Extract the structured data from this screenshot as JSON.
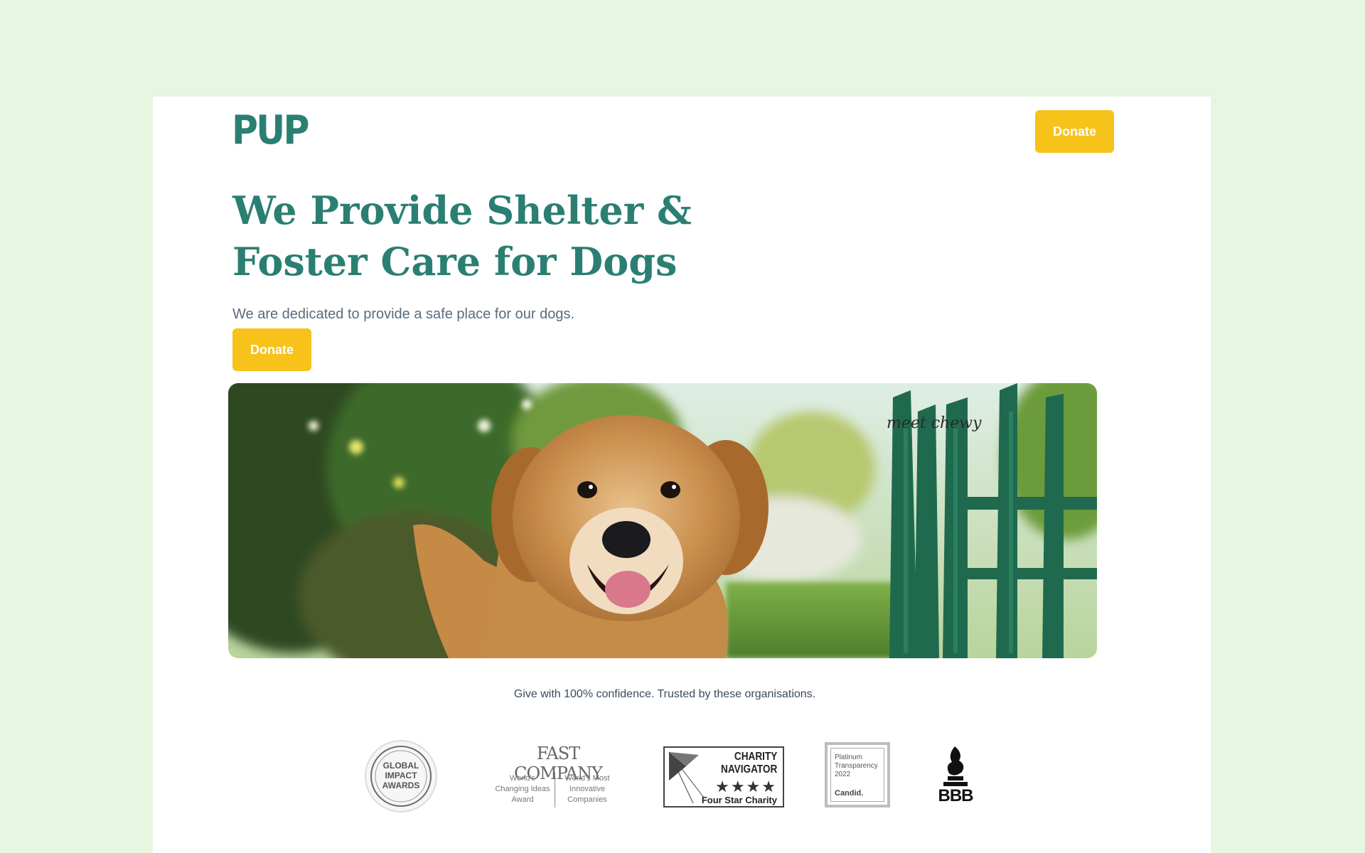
{
  "brand": {
    "logo_text": "PUP"
  },
  "nav": {
    "donate_label": "Donate"
  },
  "hero": {
    "title_line1": "We Provide Shelter &",
    "title_line2": "Foster Care for Dogs",
    "subtitle": "We are dedicated to provide a safe place for our dogs.",
    "donate_label": "Donate",
    "photo_caption": "meet chewy"
  },
  "trust": {
    "text": "Give with 100% confidence. Trusted by these organisations.",
    "logos": {
      "global_impact": {
        "line1": "GLOBAL",
        "line2": "IMPACT",
        "line3": "AWARDS"
      },
      "fast_company": {
        "wordmark": "FAST COMPANY",
        "left_l1": "World's",
        "left_l2": "Changing Ideas",
        "left_l3": "Award",
        "right_l1": "World's Most",
        "right_l2": "Innovative",
        "right_l3": "Companies"
      },
      "charity_navigator": {
        "line1": "CHARITY",
        "line2": "NAVIGATOR",
        "stars": "★★★★",
        "tagline": "Four Star Charity"
      },
      "candid": {
        "line1": "Platinum",
        "line2": "Transparency",
        "line3": "2022",
        "brand": "Candid."
      },
      "bbb": {
        "text": "BBB"
      }
    }
  },
  "colors": {
    "brand_green": "#2a7f72",
    "accent_yellow": "#f7c21a",
    "page_bg": "#e8f5e1"
  }
}
